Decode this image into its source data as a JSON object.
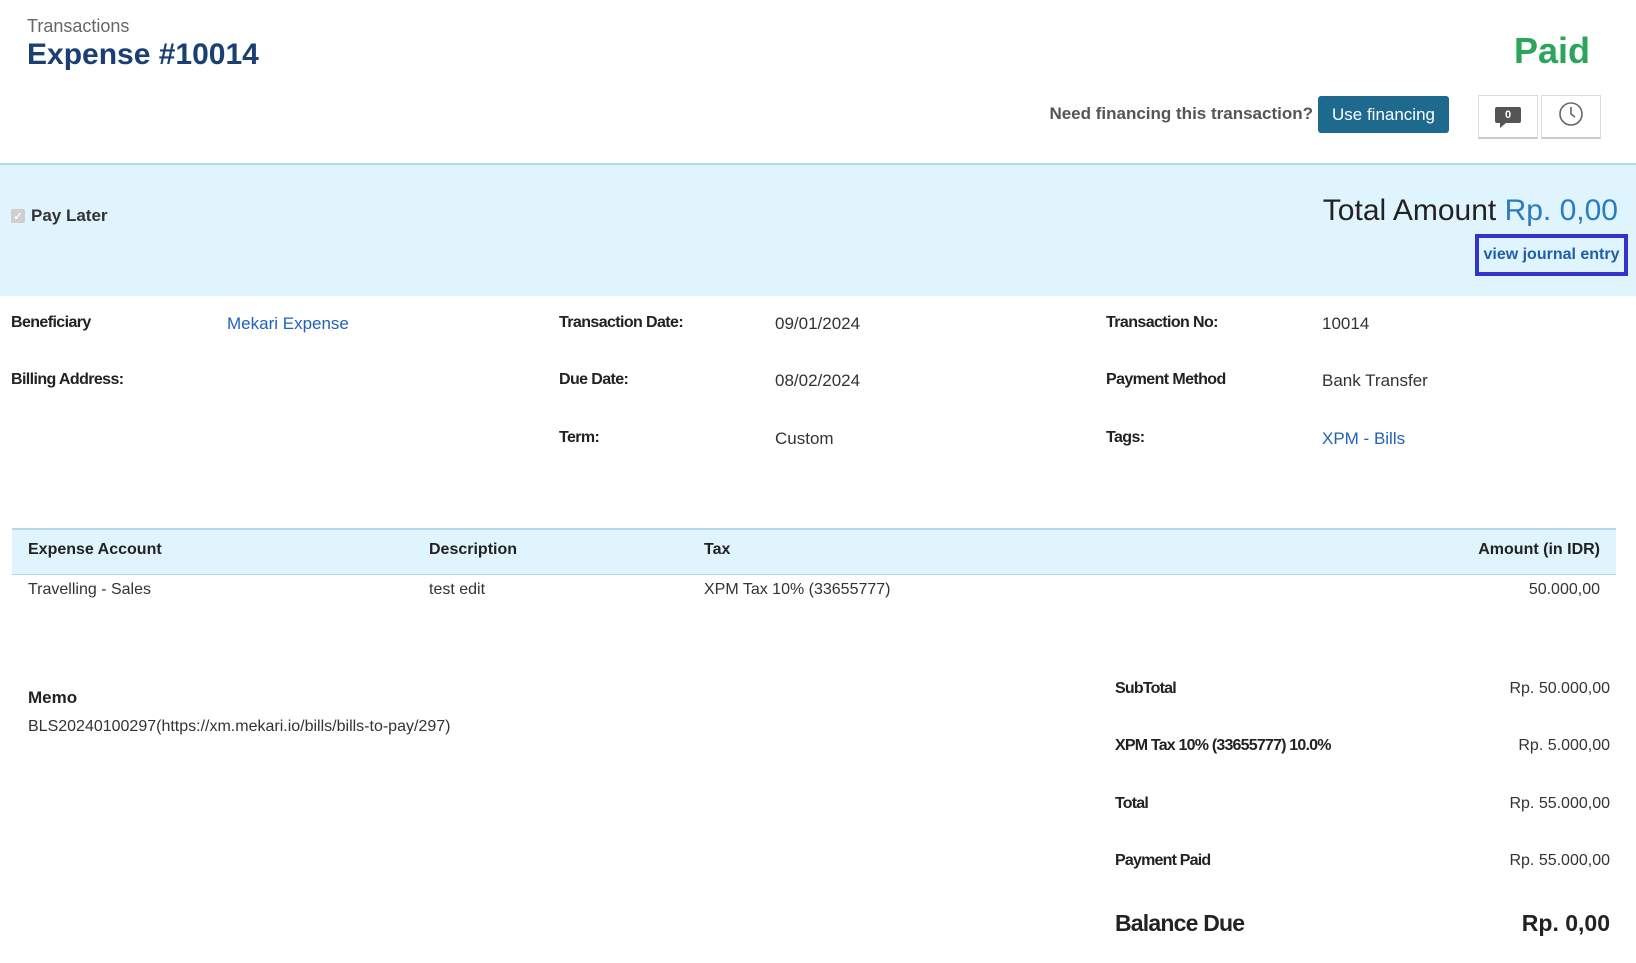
{
  "header": {
    "breadcrumb": "Transactions",
    "title": "Expense #10014",
    "status": "Paid",
    "financing_question": "Need financing this transaction?",
    "financing_button": "Use financing",
    "comment_count": "0",
    "icons": [
      "comment-icon",
      "history-clock-icon"
    ]
  },
  "band": {
    "pay_later_label": "Pay Later",
    "total_label": "Total Amount",
    "total_value": "Rp. 0,00",
    "journal_link": "view journal entry"
  },
  "details": {
    "beneficiary_label": "Beneficiary",
    "beneficiary_value": "Mekari Expense",
    "billing_label": "Billing Address:",
    "trans_date_label": "Transaction Date:",
    "trans_date_value": "09/01/2024",
    "due_date_label": "Due Date:",
    "due_date_value": "08/02/2024",
    "term_label": "Term:",
    "term_value": "Custom",
    "trans_no_label": "Transaction No:",
    "trans_no_value": "10014",
    "payment_method_label": "Payment Method",
    "payment_method_value": "Bank Transfer",
    "tags_label": "Tags:",
    "tags_value": "XPM - Bills"
  },
  "table": {
    "columns": [
      "Expense Account",
      "Description",
      "Tax",
      "Amount (in IDR)"
    ],
    "rows": [
      {
        "account": "Travelling - Sales",
        "description": "test edit",
        "tax": "XPM Tax 10% (33655777)",
        "amount": "50.000,00"
      }
    ]
  },
  "memo": {
    "label": "Memo",
    "text": "BLS20240100297(https://xm.mekari.io/bills/bills-to-pay/297)"
  },
  "summary": {
    "subtotal_label": "SubTotal",
    "subtotal_value": "Rp. 50.000,00",
    "tax_label": "XPM Tax 10% (33655777) 10.0%",
    "tax_value": "Rp. 5.000,00",
    "total_label": "Total",
    "total_value": "Rp. 55.000,00",
    "paid_label": "Payment Paid",
    "paid_value": "Rp. 55.000,00",
    "balance_label": "Balance Due",
    "balance_value": "Rp. 0,00"
  },
  "colors": {
    "title": "#1b3f73",
    "paid": "#2aa55a",
    "button": "#1d6a8e",
    "band": "#dff4fd",
    "link": "#1f62b9",
    "highlight_border": "#3333cc"
  }
}
